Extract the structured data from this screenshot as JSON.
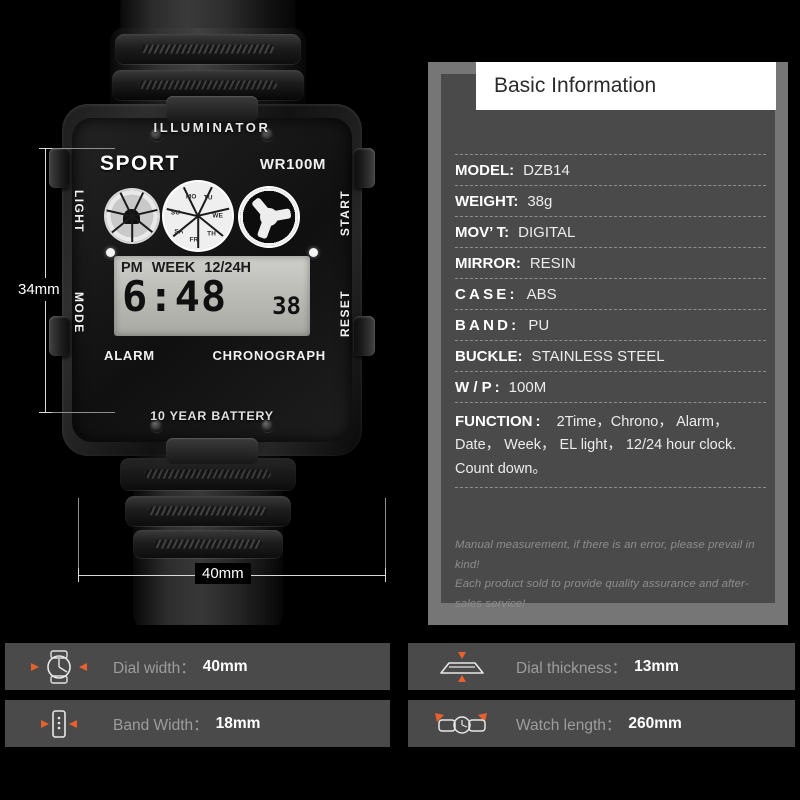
{
  "product": {
    "brand_text": "ILLUMINATOR",
    "dial_title": "SPORT",
    "water_resist": "WR100M",
    "battery_text": "10 YEAR BATTERY",
    "left_buttons": [
      "LIGHT",
      "MODE"
    ],
    "right_buttons": [
      "START",
      "RESET"
    ],
    "bottom_labels": {
      "alarm": "ALARM",
      "chronograph": "CHRONOGRAPH"
    },
    "lcd": {
      "indicator_pm": "PM",
      "indicator_week": "WEEK",
      "indicator_format": "12/24H",
      "time": "6:48",
      "seconds": "38"
    },
    "day_wheel": [
      "MO",
      "TU",
      "WE",
      "TH",
      "FR",
      "SA",
      "SU"
    ]
  },
  "dimensions": {
    "height_label": "34mm",
    "width_label": "40mm"
  },
  "panel": {
    "title": "Basic Information",
    "rows": [
      {
        "key": "MODEL:",
        "value": "DZB14",
        "spaced": false
      },
      {
        "key": "WEIGHT:",
        "value": "38g",
        "spaced": false
      },
      {
        "key": "MOV’ T:",
        "value": "DIGITAL",
        "spaced": false
      },
      {
        "key": "MIRROR:",
        "value": "RESIN",
        "spaced": false
      },
      {
        "key": "CASE:",
        "value": "ABS",
        "spaced": true
      },
      {
        "key": "BAND:",
        "value": "PU",
        "spaced": true
      },
      {
        "key": "BUCKLE:",
        "value": "STAINLESS STEEL",
        "spaced": false
      },
      {
        "key": "W / P :",
        "value": "100M",
        "spaced": false
      }
    ],
    "function": {
      "key": "FUNCTION :",
      "lines": [
        "2Time，Chrono， Alarm，",
        "Date， Week， EL light， 12/24 hour clock.",
        "Count down。"
      ]
    },
    "disclaimer": [
      "Manual measurement, if there is an error, please prevail in kind!",
      "Each product sold to provide quality assurance and after-sales service!"
    ]
  },
  "specs": [
    {
      "icon": "watch-face-icon",
      "label": "Dial width：",
      "value": "40mm"
    },
    {
      "icon": "watch-band-icon",
      "label": "Band Width：",
      "value": "18mm"
    },
    {
      "icon": "watch-thickness-icon",
      "label": "Dial thickness：",
      "value": "13mm"
    },
    {
      "icon": "watch-length-icon",
      "label": "Watch length：",
      "value": "260mm"
    }
  ],
  "colors": {
    "background": "#000000",
    "panel_frame": "#767676",
    "panel_body": "#4a4a4a",
    "accent_orange": "#e8602c",
    "label_gray": "#9d9d9d"
  }
}
